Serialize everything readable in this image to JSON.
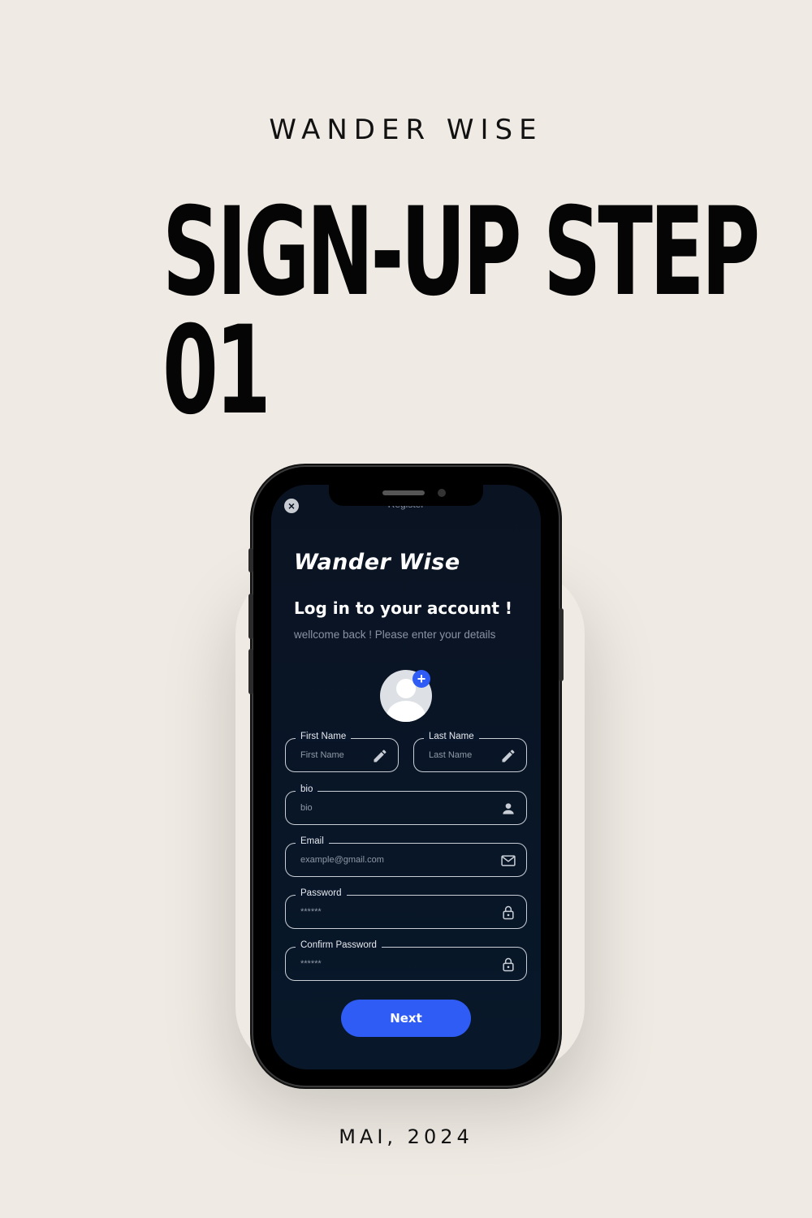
{
  "poster": {
    "brand": "WANDER WISE",
    "headline_line1": "SIGN-UP STEP",
    "headline_line2": "01",
    "date": "MAI, 2024"
  },
  "app": {
    "screen_title": "Register",
    "app_name": "Wander Wise",
    "heading": "Log in to your account !",
    "subheading": "wellcome back ! Please enter your details",
    "avatar_add_label": "+",
    "fields": {
      "first_name": {
        "label": "First Name",
        "placeholder": "First Name",
        "icon": "pencil-icon"
      },
      "last_name": {
        "label": "Last Name",
        "placeholder": "Last Name",
        "icon": "pencil-icon"
      },
      "bio": {
        "label": "bio",
        "placeholder": "bio",
        "icon": "person-icon"
      },
      "email": {
        "label": "Email",
        "placeholder": "example@gmail.com",
        "icon": "mail-icon"
      },
      "password": {
        "label": "Password",
        "placeholder": "******",
        "icon": "lock-icon"
      },
      "confirm_password": {
        "label": "Confirm Password",
        "placeholder": "******",
        "icon": "lock-icon"
      }
    },
    "next_label": "Next",
    "accent_color": "#2f5cf5",
    "screen_color": "#0a1322"
  }
}
